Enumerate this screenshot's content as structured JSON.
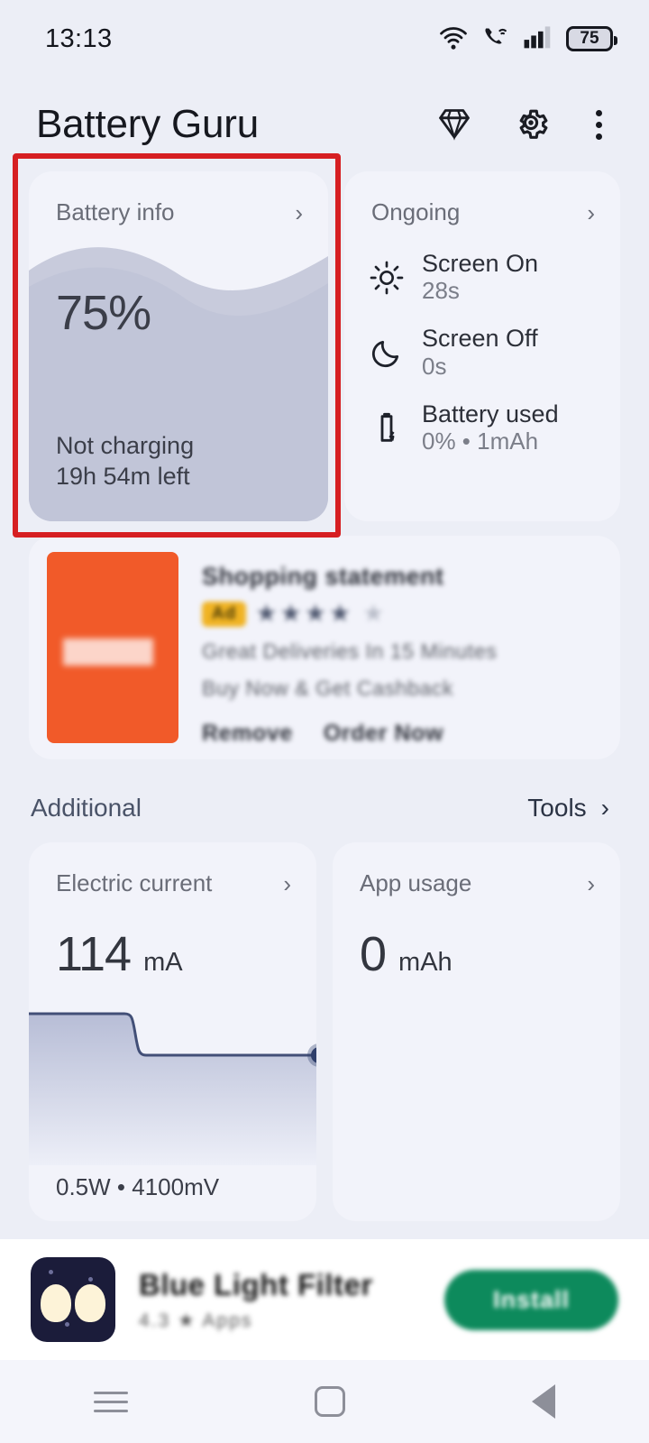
{
  "status_bar": {
    "time": "13:13",
    "battery_level": "75",
    "icons": [
      "wifi-icon",
      "call-over-wifi-icon",
      "signal-bars-icon",
      "battery-icon"
    ]
  },
  "app_bar": {
    "title": "Battery Guru",
    "actions": [
      "diamond-icon",
      "gear-icon",
      "overflow-menu-icon"
    ]
  },
  "battery_info": {
    "title": "Battery info",
    "chevron": "›",
    "percent": "75%",
    "percent_value": 75,
    "status": "Not charging",
    "remaining": "19h 54m left",
    "highlight_color": "#d61f22"
  },
  "ongoing": {
    "title": "Ongoing",
    "chevron": "›",
    "items": [
      {
        "icon": "sun-icon",
        "label": "Screen On",
        "value": "28s"
      },
      {
        "icon": "moon-icon",
        "label": "Screen Off",
        "value": "0s"
      },
      {
        "icon": "battery-bolt-icon",
        "label": "Battery used",
        "value": "0% • 1mAh"
      }
    ]
  },
  "ad_card": {
    "badge": "Ad",
    "headline": "Shopping statement",
    "description_line1": "Great Deliveries In 15 Minutes",
    "description_line2": "Buy Now & Get Cashback",
    "stars_filled": 4,
    "stars_total": 5,
    "links": [
      "Remove",
      "Order Now"
    ],
    "thumb_color": "#f15a29"
  },
  "section": {
    "left_label": "Additional",
    "right_label": "Tools",
    "chevron": "›"
  },
  "electric_current": {
    "title": "Electric current",
    "chevron": "›",
    "value": "114",
    "unit": "mA",
    "footer": "0.5W • 4100mV"
  },
  "app_usage": {
    "title": "App usage",
    "chevron": "›",
    "value": "0",
    "unit": "mAh"
  },
  "banner_ad": {
    "title": "Blue Light Filter",
    "subtitle": "4.3 ★  Apps",
    "button_label": "Install",
    "button_color": "#0d8a5c"
  },
  "nav_bar": {
    "items": [
      "recents-button",
      "home-button",
      "back-button"
    ]
  },
  "chart_data": {
    "type": "line",
    "title": "Electric current",
    "ylabel": "mA",
    "x": [
      0,
      10,
      20,
      30,
      38,
      42,
      50,
      60,
      70,
      80,
      90,
      100
    ],
    "values": [
      152,
      152,
      152,
      152,
      152,
      114,
      114,
      114,
      114,
      114,
      114,
      114
    ],
    "current_value": 114,
    "grid": false,
    "legend": "none",
    "line_color": "#424f77",
    "fill_gradient": [
      "#b9bfd8",
      "#eceef8"
    ]
  }
}
